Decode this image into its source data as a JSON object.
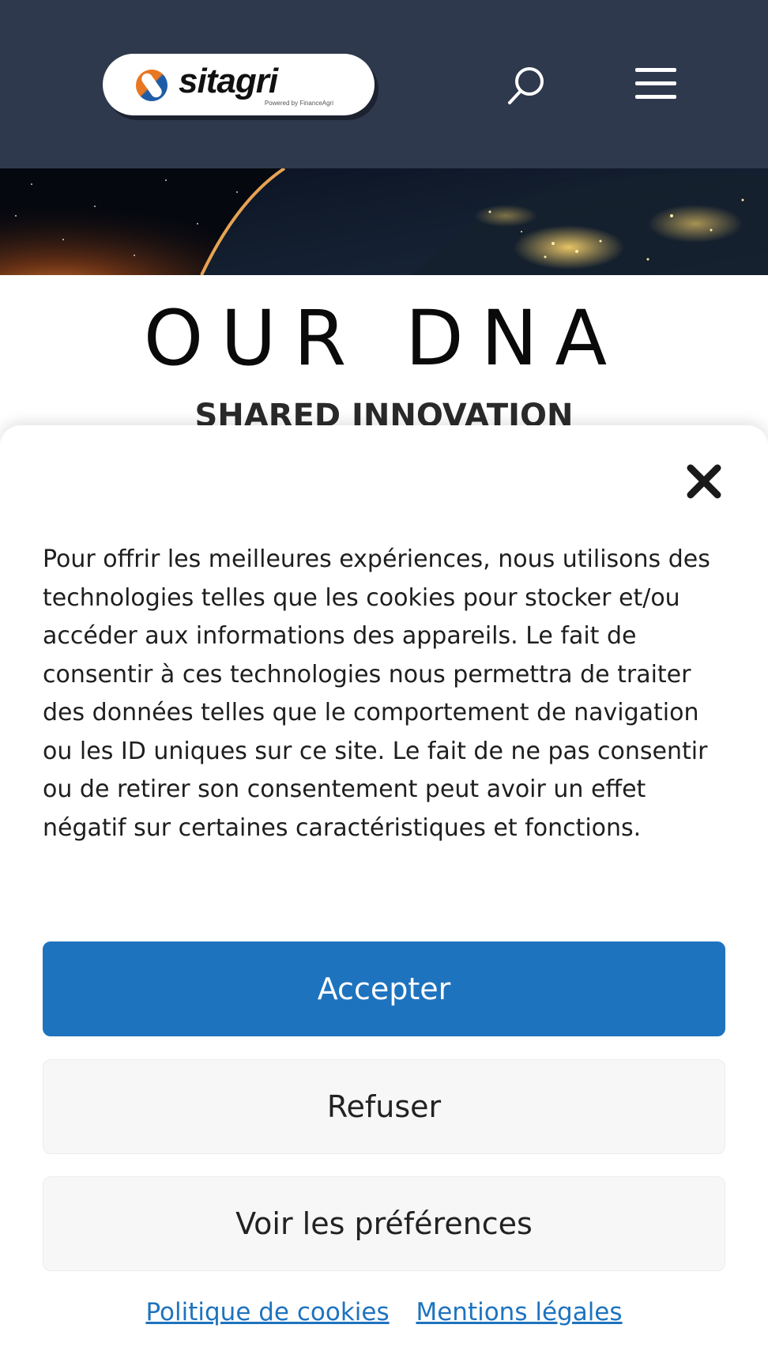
{
  "header": {
    "logo": {
      "text": "sitagri",
      "subtext": "Powered by FinanceAgri"
    },
    "icons": {
      "search": "search-icon",
      "menu": "hamburger-menu-icon"
    },
    "background_color": "#2f394d"
  },
  "hero": {
    "image": "earth-from-space-night-lights"
  },
  "main": {
    "title": "OUR DNA",
    "subtitle": "SHARED INNOVATION"
  },
  "cookie_banner": {
    "close_icon": "close-icon",
    "message": "Pour offrir les meilleures expériences, nous utilisons des technologies telles que les cookies pour stocker et/ou accéder aux informations des appareils. Le fait de consentir à ces technologies nous permettra de traiter des données telles que le comportement de navigation ou les ID uniques sur ce site. Le fait de ne pas consentir ou de retirer son consentement peut avoir un effet négatif sur certaines caractéristiques et fonctions.",
    "accept_label": "Accepter",
    "deny_label": "Refuser",
    "preferences_label": "Voir les préférences",
    "links": {
      "cookie_policy": "Politique de cookies",
      "legal_notice": "Mentions légales"
    },
    "accent_color": "#1e73be"
  }
}
